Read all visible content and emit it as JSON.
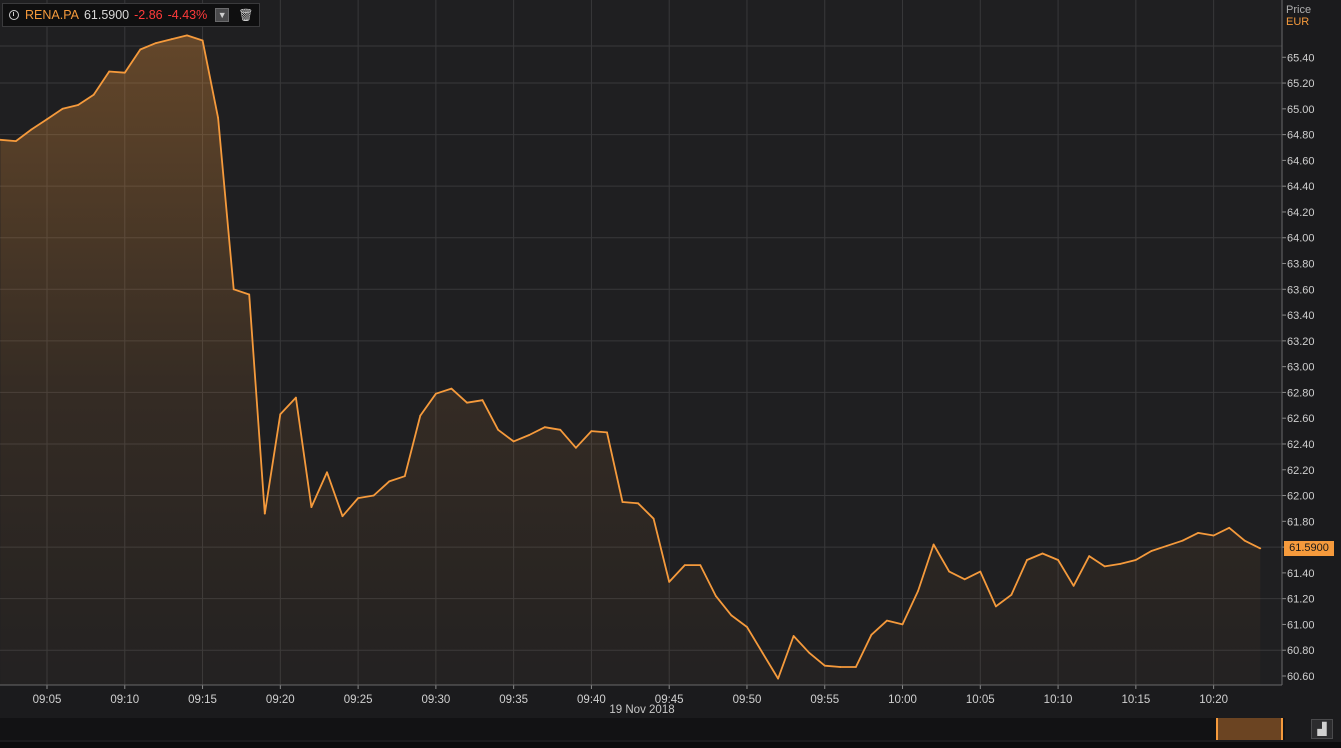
{
  "legend": {
    "symbol": "RENA.PA",
    "last": "61.5900",
    "change": "-2.86",
    "change_pct": "-4.43%"
  },
  "axis": {
    "title": "Price",
    "unit": "EUR"
  },
  "current_price_tag": "61.5900",
  "date_label": "19 Nov 2018",
  "colors": {
    "line": "#f59a3c",
    "background": "#1b1b1d",
    "grid": "#3a3a3c",
    "negative": "#ff3b3b"
  },
  "icons": [
    "clock-icon",
    "chevron-down-icon",
    "trash-icon",
    "chart-navigator-icon"
  ],
  "chart_data": {
    "type": "area",
    "title": "",
    "xlabel": "19 Nov 2018",
    "ylabel": "Price EUR",
    "ylim": [
      60.52,
      65.54
    ],
    "xlim": [
      "09:02",
      "10:24"
    ],
    "grid": true,
    "x_ticks": [
      "09:05",
      "09:10",
      "09:15",
      "09:20",
      "09:25",
      "09:30",
      "09:35",
      "09:40",
      "09:45",
      "09:50",
      "09:55",
      "10:00",
      "10:05",
      "10:10",
      "10:15",
      "10:20"
    ],
    "y_ticks": [
      "60.60",
      "60.80",
      "61.00",
      "61.20",
      "61.40",
      "61.60",
      "61.80",
      "62.00",
      "62.20",
      "62.40",
      "62.60",
      "62.80",
      "63.00",
      "63.20",
      "63.40",
      "63.60",
      "63.80",
      "64.00",
      "64.20",
      "64.40",
      "64.60",
      "64.80",
      "65.00",
      "65.20",
      "65.40"
    ],
    "series": [
      {
        "name": "RENA.PA",
        "points": [
          [
            "09:02",
            64.76
          ],
          [
            "09:03",
            64.75
          ],
          [
            "09:04",
            64.84
          ],
          [
            "09:05",
            64.92
          ],
          [
            "09:06",
            65.0
          ],
          [
            "09:07",
            65.03
          ],
          [
            "09:08",
            65.11
          ],
          [
            "09:09",
            65.29
          ],
          [
            "09:10",
            65.28
          ],
          [
            "09:11",
            65.46
          ],
          [
            "09:12",
            65.51
          ],
          [
            "09:13",
            65.54
          ],
          [
            "09:14",
            65.57
          ],
          [
            "09:15",
            65.53
          ],
          [
            "09:16",
            64.93
          ],
          [
            "09:17",
            63.6
          ],
          [
            "09:18",
            63.56
          ],
          [
            "09:19",
            61.86
          ],
          [
            "09:20",
            62.63
          ],
          [
            "09:21",
            62.76
          ],
          [
            "09:22",
            61.91
          ],
          [
            "09:23",
            62.18
          ],
          [
            "09:24",
            61.84
          ],
          [
            "09:25",
            61.98
          ],
          [
            "09:26",
            62.0
          ],
          [
            "09:27",
            62.11
          ],
          [
            "09:28",
            62.15
          ],
          [
            "09:29",
            62.62
          ],
          [
            "09:30",
            62.79
          ],
          [
            "09:31",
            62.83
          ],
          [
            "09:32",
            62.72
          ],
          [
            "09:33",
            62.74
          ],
          [
            "09:34",
            62.51
          ],
          [
            "09:35",
            62.42
          ],
          [
            "09:36",
            62.47
          ],
          [
            "09:37",
            62.53
          ],
          [
            "09:38",
            62.51
          ],
          [
            "09:39",
            62.37
          ],
          [
            "09:40",
            62.5
          ],
          [
            "09:41",
            62.49
          ],
          [
            "09:42",
            61.95
          ],
          [
            "09:43",
            61.94
          ],
          [
            "09:44",
            61.82
          ],
          [
            "09:45",
            61.33
          ],
          [
            "09:46",
            61.46
          ],
          [
            "09:47",
            61.46
          ],
          [
            "09:48",
            61.22
          ],
          [
            "09:49",
            61.07
          ],
          [
            "09:50",
            60.98
          ],
          [
            "09:51",
            60.78
          ],
          [
            "09:52",
            60.58
          ],
          [
            "09:53",
            60.91
          ],
          [
            "09:54",
            60.78
          ],
          [
            "09:55",
            60.68
          ],
          [
            "09:56",
            60.67
          ],
          [
            "09:57",
            60.67
          ],
          [
            "09:58",
            60.92
          ],
          [
            "09:59",
            61.03
          ],
          [
            "10:00",
            61.0
          ],
          [
            "10:01",
            61.26
          ],
          [
            "10:02",
            61.62
          ],
          [
            "10:03",
            61.41
          ],
          [
            "10:04",
            61.35
          ],
          [
            "10:05",
            61.41
          ],
          [
            "10:06",
            61.14
          ],
          [
            "10:07",
            61.23
          ],
          [
            "10:08",
            61.5
          ],
          [
            "10:09",
            61.55
          ],
          [
            "10:10",
            61.5
          ],
          [
            "10:11",
            61.3
          ],
          [
            "10:12",
            61.53
          ],
          [
            "10:13",
            61.45
          ],
          [
            "10:14",
            61.47
          ],
          [
            "10:15",
            61.5
          ],
          [
            "10:16",
            61.57
          ],
          [
            "10:17",
            61.61
          ],
          [
            "10:18",
            61.65
          ],
          [
            "10:19",
            61.71
          ],
          [
            "10:20",
            61.69
          ],
          [
            "10:21",
            61.75
          ],
          [
            "10:22",
            61.65
          ],
          [
            "10:23",
            61.59
          ]
        ]
      }
    ]
  }
}
